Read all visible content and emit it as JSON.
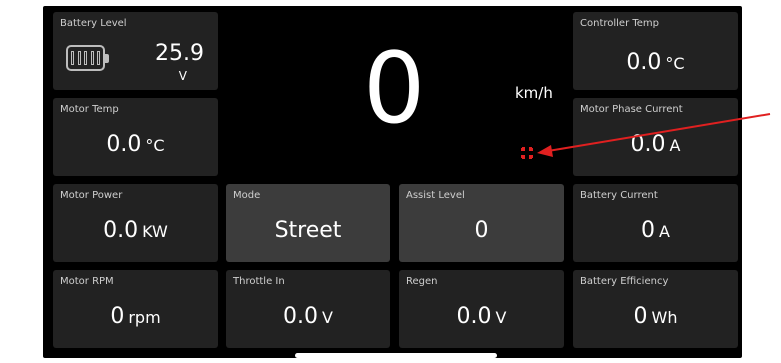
{
  "battery_level": {
    "label": "Battery Level",
    "value": "25.9",
    "unit": "V"
  },
  "speed": {
    "value": "0",
    "unit": "km/h"
  },
  "controller_temp": {
    "label": "Controller Temp",
    "value": "0.0",
    "unit": "°C"
  },
  "motor_temp": {
    "label": "Motor Temp",
    "value": "0.0",
    "unit": "°C"
  },
  "motor_phase_current": {
    "label": "Motor Phase Current",
    "value": "0.0",
    "unit": "A"
  },
  "motor_power": {
    "label": "Motor Power",
    "value": "0.0",
    "unit": "KW"
  },
  "mode": {
    "label": "Mode",
    "value": "Street"
  },
  "assist_level": {
    "label": "Assist Level",
    "value": "0"
  },
  "battery_current": {
    "label": "Battery Current",
    "value": "0",
    "unit": "A"
  },
  "motor_rpm": {
    "label": "Motor RPM",
    "value": "0",
    "unit": "rpm"
  },
  "throttle_in": {
    "label": "Throttle In",
    "value": "0.0",
    "unit": "V"
  },
  "regen": {
    "label": "Regen",
    "value": "0.0",
    "unit": "V"
  },
  "battery_efficiency": {
    "label": "Battery Efficiency",
    "value": "0",
    "unit": "Wh"
  },
  "icons": {
    "battery": "battery-icon",
    "crosshair": "crosshair-icon",
    "annotation": "annotation-arrow"
  },
  "colors": {
    "background": "#000000",
    "card": "#222222",
    "card_selected": "#3c3c3c",
    "accent": "#e02020",
    "text": "#ffffff"
  }
}
